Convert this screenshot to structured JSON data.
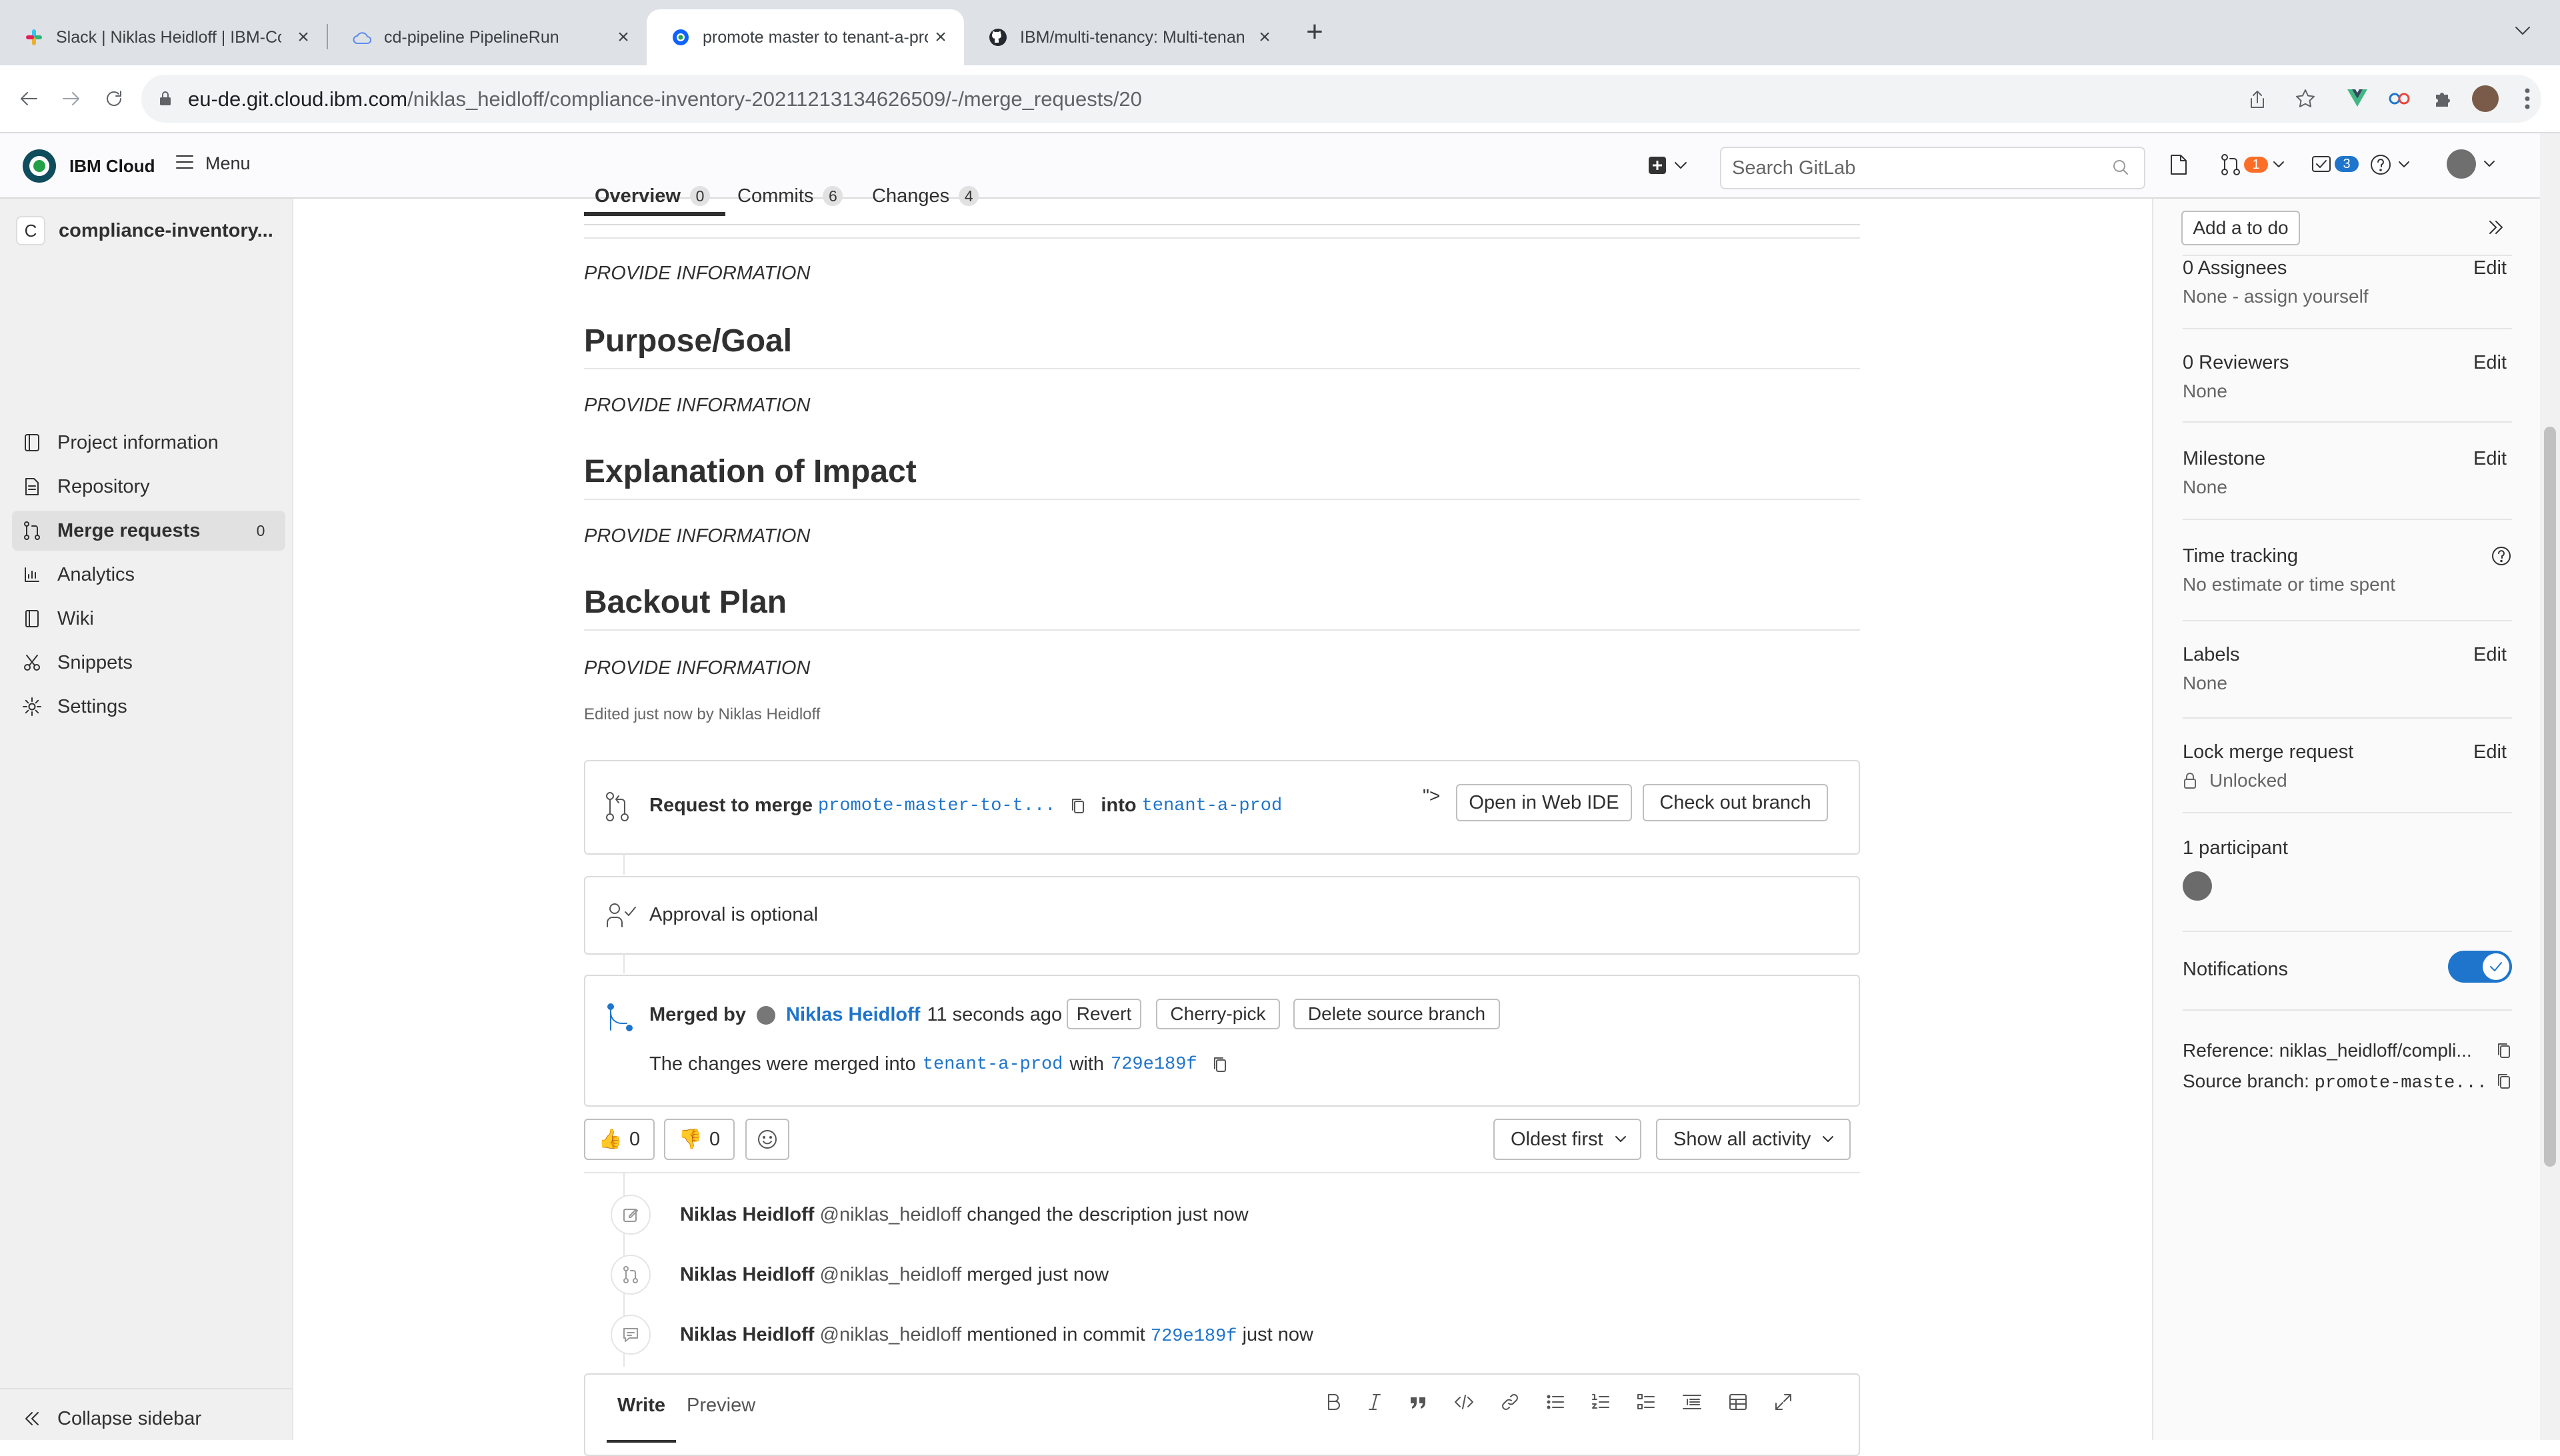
{
  "browser": {
    "tabs": [
      {
        "title": "Slack | Niklas Heidloff | IBM-Co",
        "icon": "slack-icon",
        "active": false
      },
      {
        "title": "cd-pipeline PipelineRun",
        "icon": "cloud-icon",
        "active": false
      },
      {
        "title": "promote master to tenant-a-pro",
        "icon": "ibm-cloud-icon",
        "active": true
      },
      {
        "title": "IBM/multi-tenancy: Multi-tenan",
        "icon": "github-icon",
        "active": false
      }
    ],
    "url_host": "eu-de.git.cloud.ibm.com",
    "url_path": "/niklas_heidloff/compliance-inventory-20211213134626509/-/merge_requests/20"
  },
  "header": {
    "brand": "IBM Cloud",
    "menu_label": "Menu",
    "search_placeholder": "Search GitLab",
    "mr_badge": "1",
    "todo_badge": "3",
    "mr_badge_color": "#fc6d26",
    "todo_badge_color": "#1f75cb"
  },
  "sidebar": {
    "project_initial": "C",
    "project_name": "compliance-inventory...",
    "items": [
      {
        "label": "Project information",
        "icon": "info-icon"
      },
      {
        "label": "Repository",
        "icon": "repository-icon"
      },
      {
        "label": "Merge requests",
        "icon": "merge-request-icon",
        "count": "0",
        "active": true
      },
      {
        "label": "Analytics",
        "icon": "analytics-icon"
      },
      {
        "label": "Wiki",
        "icon": "wiki-icon"
      },
      {
        "label": "Snippets",
        "icon": "snippets-icon"
      },
      {
        "label": "Settings",
        "icon": "settings-icon"
      }
    ],
    "collapse_label": "Collapse sidebar"
  },
  "tabs": [
    {
      "label": "Overview",
      "count": "0",
      "active": true
    },
    {
      "label": "Commits",
      "count": "6"
    },
    {
      "label": "Changes",
      "count": "4"
    }
  ],
  "description": {
    "intro": "PROVIDE INFORMATION",
    "sections": [
      {
        "heading": "Purpose/Goal",
        "body": "PROVIDE INFORMATION"
      },
      {
        "heading": "Explanation of Impact",
        "body": "PROVIDE INFORMATION"
      },
      {
        "heading": "Backout Plan",
        "body": "PROVIDE INFORMATION"
      }
    ],
    "edited": "Edited just now by Niklas Heidloff"
  },
  "merge_widget": {
    "request_label": "Request to merge",
    "source_branch": "promote-master-to-t...",
    "into_label": "into",
    "target_branch": "tenant-a-prod",
    "stray_text": "\">",
    "open_ide": "Open in Web IDE",
    "checkout": "Check out branch"
  },
  "approval": {
    "text": "Approval is optional"
  },
  "merged": {
    "label": "Merged by",
    "user": "Niklas Heidloff",
    "time": "11 seconds ago",
    "revert": "Revert",
    "cherry_pick": "Cherry-pick",
    "delete_branch": "Delete source branch",
    "changes_prefix": "The changes were merged into",
    "target": "tenant-a-prod",
    "with": "with",
    "commit": "729e189f"
  },
  "reactions": {
    "thumbs_up": "👍",
    "thumbs_up_count": "0",
    "thumbs_down": "👎",
    "thumbs_down_count": "0",
    "sort": "Oldest first",
    "filter": "Show all activity"
  },
  "activity": [
    {
      "user": "Niklas Heidloff",
      "handle": "@niklas_heidloff",
      "action": "changed the description",
      "time": "just now",
      "icon": "pencil-icon"
    },
    {
      "user": "Niklas Heidloff",
      "handle": "@niklas_heidloff",
      "action": "merged",
      "time": "just now",
      "icon": "merge-icon"
    },
    {
      "user": "Niklas Heidloff",
      "handle": "@niklas_heidloff",
      "action": "mentioned in commit",
      "commit": "729e189f",
      "time": "just now",
      "icon": "comment-icon"
    }
  ],
  "editor": {
    "write": "Write",
    "preview": "Preview"
  },
  "right_sidebar": {
    "todo": "Add a to do",
    "assignees_title": "0 Assignees",
    "assignees_value": "None - assign yourself",
    "reviewers_title": "0 Reviewers",
    "reviewers_value": "None",
    "milestone_title": "Milestone",
    "milestone_value": "None",
    "time_title": "Time tracking",
    "time_value": "No estimate or time spent",
    "labels_title": "Labels",
    "labels_value": "None",
    "lock_title": "Lock merge request",
    "lock_value": "Unlocked",
    "participants_title": "1 participant",
    "notifications_title": "Notifications",
    "notifications_on": true,
    "reference": "Reference: niklas_heidloff/compli...",
    "source_prefix": "Source branch:",
    "source_value": "promote-maste...",
    "edit": "Edit"
  }
}
